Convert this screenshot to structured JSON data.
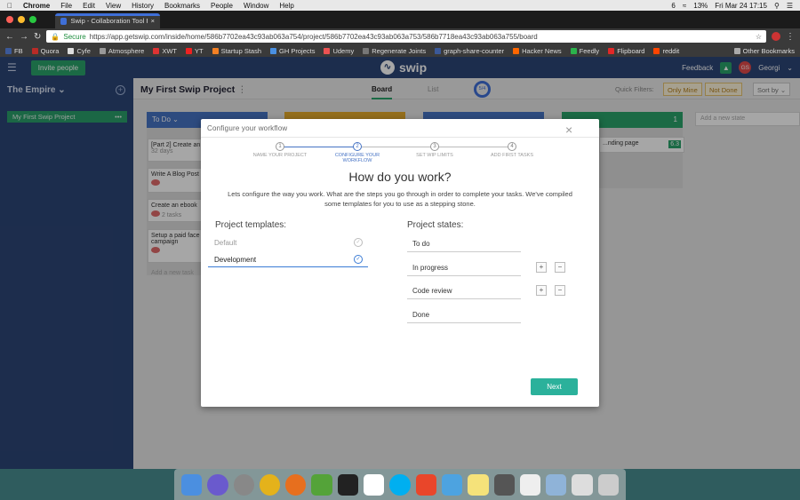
{
  "mac_menu": {
    "app": "Chrome",
    "items": [
      "File",
      "Edit",
      "View",
      "History",
      "Bookmarks",
      "People",
      "Window",
      "Help"
    ],
    "battery": "13%",
    "datetime": "Fri Mar 24  17:15",
    "notification_count": "6"
  },
  "browser": {
    "tab_title": "Swip - Collaboration Tool For",
    "secure_label": "Secure",
    "url": "https://app.getswip.com/inside/home/586b7702ea43c93ab063a754/project/586b7702ea43c93ab063a753/586b7718ea43c93ab063a755/board",
    "bookmarks": [
      "FB",
      "Quora",
      "Cyfe",
      "Atmosphere",
      "XWT",
      "YT",
      "Startup Stash",
      "GH Projects",
      "Udemy",
      "Regenerate Joints",
      "graph-share-counter",
      "Hacker News",
      "Feedly",
      "Flipboard",
      "reddit"
    ],
    "other_bookmarks": "Other Bookmarks"
  },
  "app": {
    "invite_label": "Invite people",
    "logo_text": "swip",
    "feedback_label": "Feedback",
    "user_initials": "GS",
    "user_name": "Georgi",
    "team_name": "The Empire",
    "project_name": "My First Swip Project",
    "board_tab": "Board",
    "list_tab": "List",
    "progress_label": "5/4",
    "quick_filters_label": "Quick Filters:",
    "filter_only_mine": "Only Mine",
    "filter_not_done": "Not Done",
    "sort_label": "Sort by",
    "col_todo_title": "To Do",
    "col_done_count": "1",
    "add_new_state": "Add a new state",
    "cards": [
      {
        "title": "[Part 2] Create an",
        "sub": "32 days"
      },
      {
        "title": "Write A Blog Post"
      },
      {
        "title": "Create an ebook",
        "sub": "2 tasks"
      },
      {
        "title": "Setup a paid face campaign"
      }
    ],
    "add_task_placeholder": "Add a new task",
    "landing_card": "...nding page",
    "landing_score": "6.3"
  },
  "modal": {
    "title": "Configure your workflow",
    "steps": [
      {
        "num": "1",
        "label": "NAME YOUR PROJECT"
      },
      {
        "num": "2",
        "label": "CONFIGURE YOUR WORKFLOW"
      },
      {
        "num": "3",
        "label": "SET WIP LIMITS"
      },
      {
        "num": "4",
        "label": "ADD FIRST TASKS"
      }
    ],
    "heading": "How do you work?",
    "description": "Lets configure the way you work. What are the steps you go through in order to complete your tasks. We've compiled some templates for you to use as a stepping stone.",
    "templates_label": "Project templates:",
    "templates": [
      "Default",
      "Development"
    ],
    "states_label": "Project states:",
    "states": [
      "To do",
      "In progress",
      "Code review",
      "Done"
    ],
    "next_label": "Next"
  }
}
